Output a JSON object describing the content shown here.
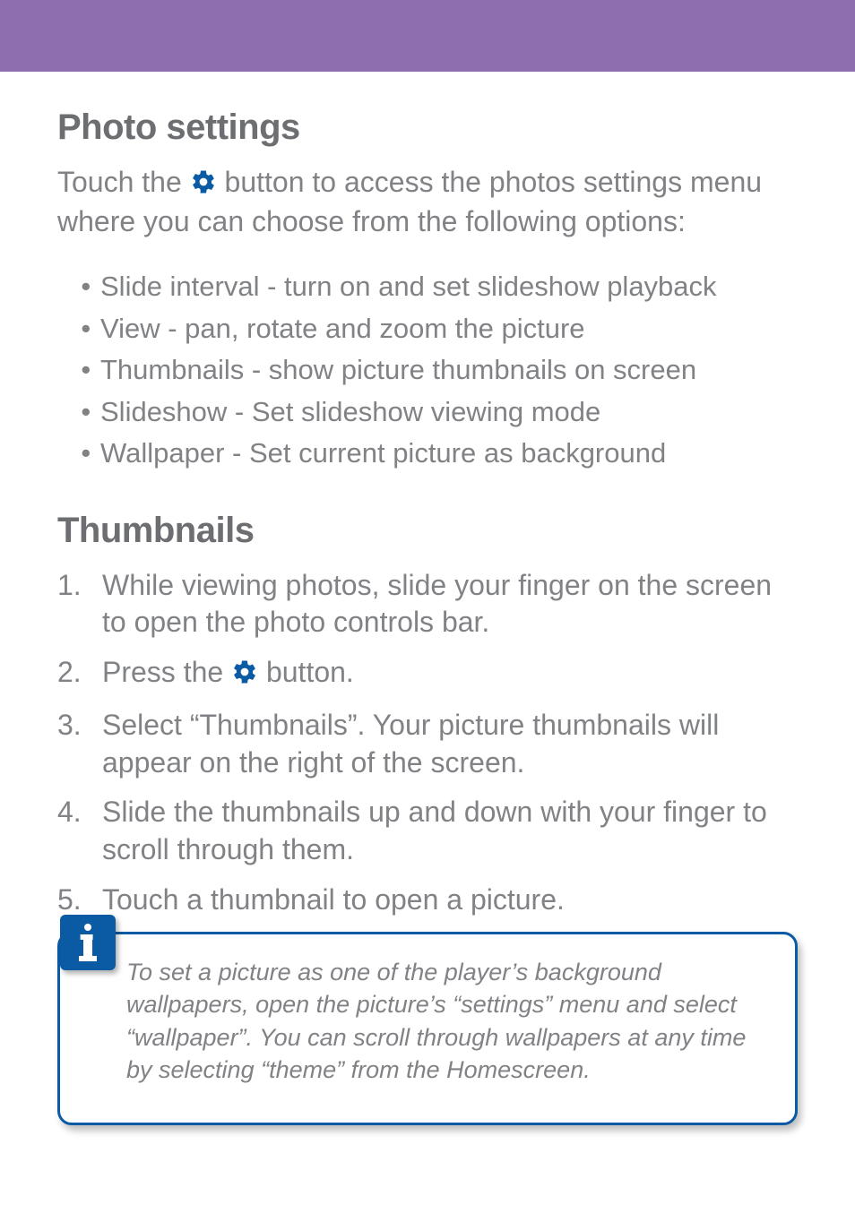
{
  "header_band_color": "#8e6eaf",
  "sections": {
    "photo_settings": {
      "title": "Photo settings",
      "intro_before": "Touch the ",
      "intro_after": " button to access the photos settings menu where you can choose from the following options:",
      "bullets": [
        "Slide interval - turn on and set slideshow playback",
        "View - pan, rotate and zoom the picture",
        "Thumbnails - show picture thumbnails on screen",
        "Slideshow - Set slideshow viewing mode",
        "Wallpaper - Set current picture as background"
      ]
    },
    "thumbnails": {
      "title": "Thumbnails",
      "steps": [
        "While viewing photos, slide your finger on the screen to open the photo controls bar.",
        "__GEAR__",
        "Select “Thumbnails”.  Your picture thumbnails will appear on the right of the screen.",
        "Slide the thumbnails up and down with your finger to scroll through them.",
        "Touch a thumbnail to open a picture."
      ],
      "step2_before": "Press the ",
      "step2_after": " button."
    }
  },
  "info_box": {
    "text": "To set a picture as one of the player’s background wallpapers, open the picture’s “settings” menu and select “wallpaper”. You can scroll through wallpapers at any time by selecting “theme” from the Homescreen."
  },
  "icons": {
    "gear": "gear-icon",
    "info": "info-icon"
  }
}
